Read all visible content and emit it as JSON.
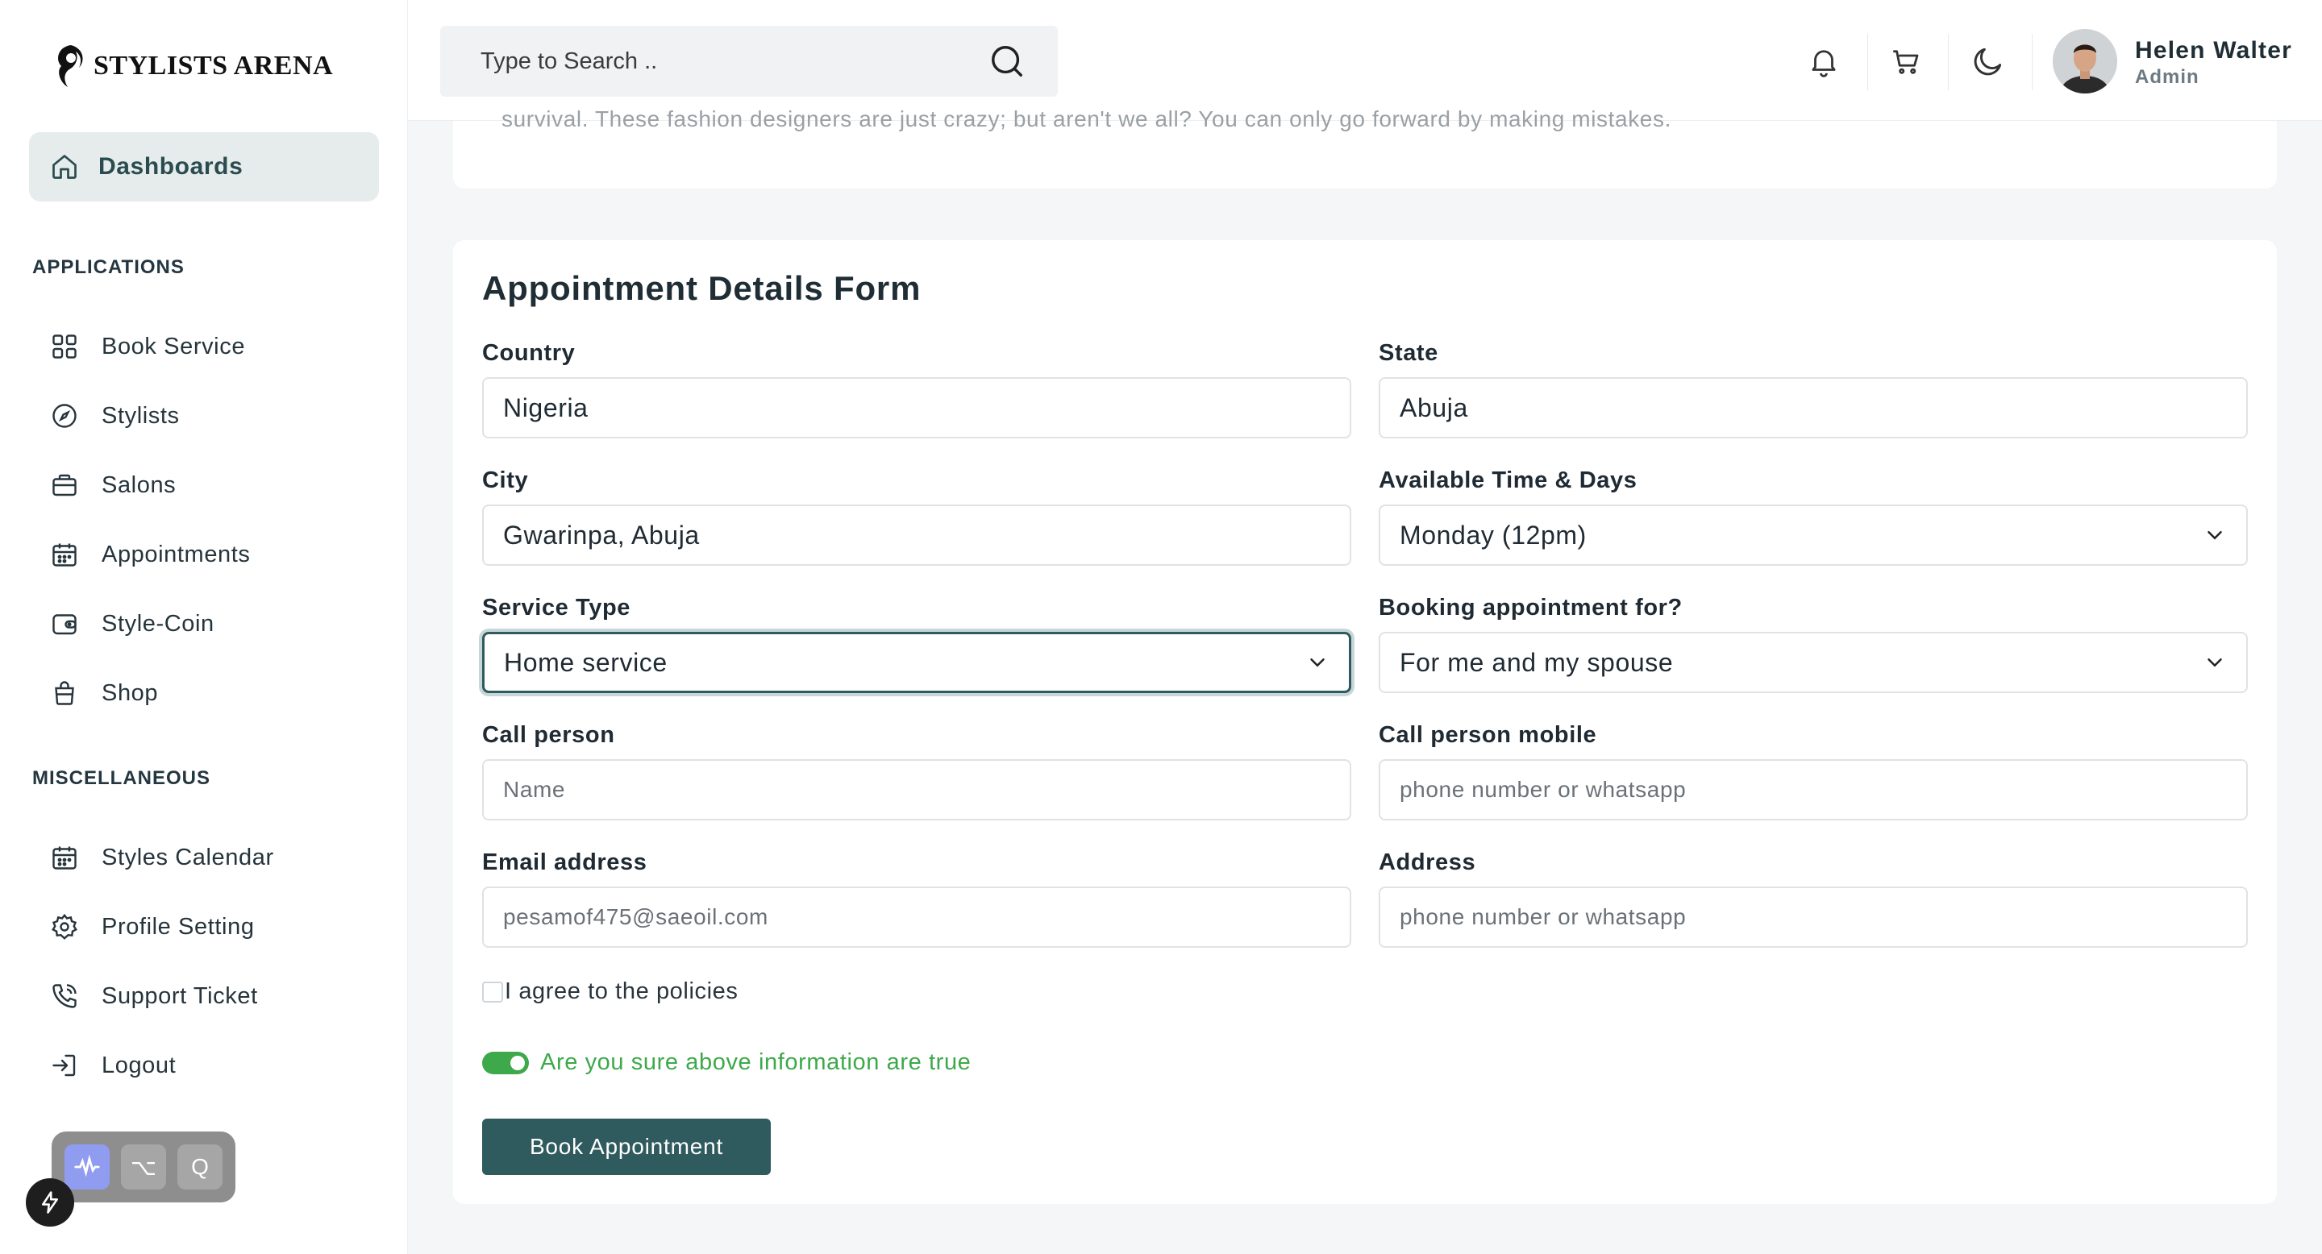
{
  "brand": {
    "name": "STYLISTS ARENA"
  },
  "sidebar": {
    "dashboard_label": "Dashboards",
    "section_applications": "APPLICATIONS",
    "applications": [
      {
        "label": "Book Service",
        "icon": "grid-icon"
      },
      {
        "label": "Stylists",
        "icon": "compass-icon"
      },
      {
        "label": "Salons",
        "icon": "briefcase-icon"
      },
      {
        "label": "Appointments",
        "icon": "calendar-icon"
      },
      {
        "label": "Style-Coin",
        "icon": "wallet-icon"
      },
      {
        "label": "Shop",
        "icon": "shopping-bag-icon"
      }
    ],
    "section_misc": "MISCELLANEOUS",
    "misc": [
      {
        "label": "Styles Calendar",
        "icon": "calendar-icon"
      },
      {
        "label": "Profile Setting",
        "icon": "gear-icon"
      },
      {
        "label": "Support Ticket",
        "icon": "phone-icon"
      },
      {
        "label": "Logout",
        "icon": "logout-icon"
      }
    ],
    "dock": {
      "key1": "⌥",
      "key2": "Q"
    }
  },
  "topbar": {
    "search_placeholder": "Type to Search ..",
    "user": {
      "name": "Helen Walter",
      "role": "Admin"
    }
  },
  "previous_card": {
    "text": "survival. These fashion designers are just crazy; but aren't we all? You can only go forward by making mistakes."
  },
  "form": {
    "title": "Appointment Details Form",
    "country": {
      "label": "Country",
      "value": "Nigeria"
    },
    "state": {
      "label": "State",
      "value": "Abuja"
    },
    "city": {
      "label": "City",
      "value": "Gwarinpa, Abuja"
    },
    "available": {
      "label": "Available Time & Days",
      "value": "Monday (12pm)"
    },
    "service_type": {
      "label": "Service Type",
      "value": "Home service"
    },
    "booking_for": {
      "label": "Booking appointment for?",
      "value": "For me and my spouse"
    },
    "call_person": {
      "label": "Call person",
      "placeholder": "Name"
    },
    "call_mobile": {
      "label": "Call person mobile",
      "placeholder": "phone number or whatsapp"
    },
    "email": {
      "label": "Email address",
      "placeholder": "pesamof475@saeoil.com"
    },
    "address": {
      "label": "Address",
      "placeholder": "phone number or whatsapp"
    },
    "agree_label": "I agree to the policies",
    "confirm_label": "Are you sure above information are true",
    "submit_label": "Book Appointment"
  },
  "colors": {
    "primary": "#2f5a5e",
    "active_nav_bg": "#e6ecec",
    "success": "#3da94a",
    "page_bg": "#f5f6f7"
  }
}
